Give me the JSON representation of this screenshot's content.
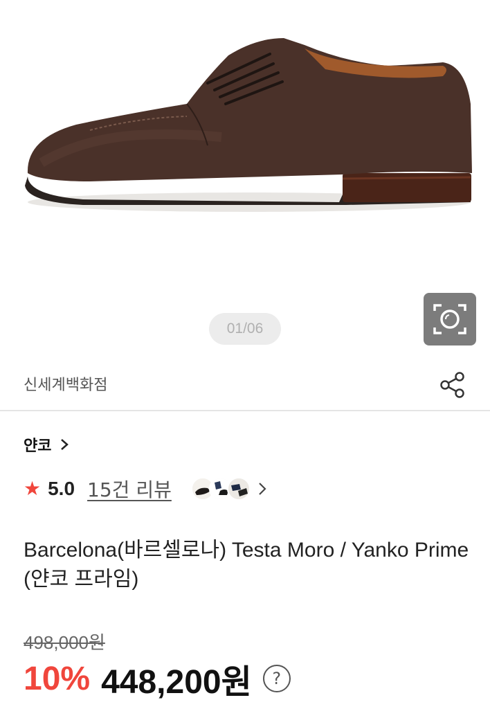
{
  "gallery": {
    "counter": "01/06",
    "image_alt": "brown suede derby shoe",
    "lens_icon": "camera-lens-icon"
  },
  "store": {
    "name": "신세계백화점",
    "share_icon": "share-icon"
  },
  "brand": {
    "name": "얀코",
    "chevron_icon": "chevron-right-icon"
  },
  "rating": {
    "score": "5.0",
    "reviews": "15건 리뷰",
    "star_color": "#f0463c"
  },
  "product": {
    "title": "Barcelona(바르셀로나) Testa Moro / Yanko Prime(얀코 프라임)"
  },
  "price": {
    "original": "498,000원",
    "discount": "10%",
    "sale": "448,200원",
    "help": "?",
    "accent_color": "#f0463c"
  }
}
